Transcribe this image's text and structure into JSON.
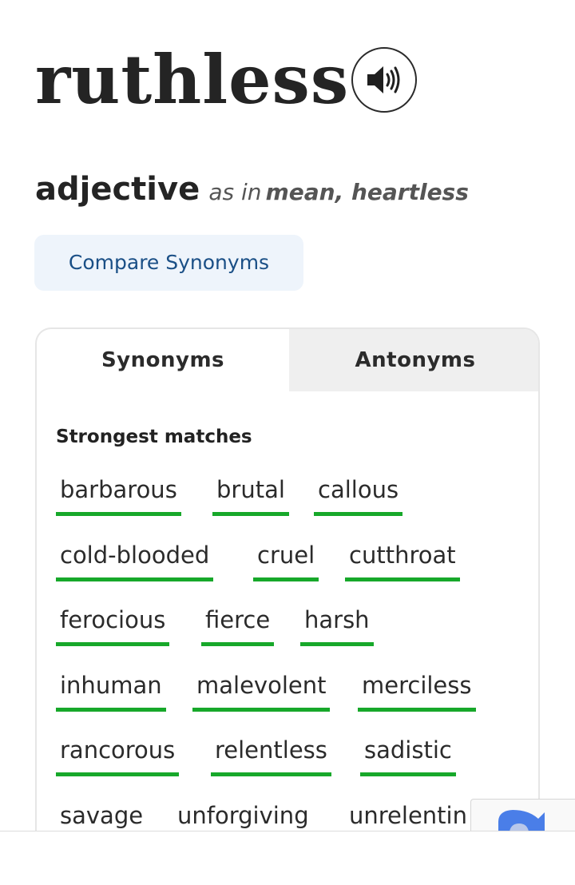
{
  "entry": {
    "word": "ruthless",
    "part_of_speech": "adjective",
    "as_in_prefix": "as in",
    "as_in_words": "mean, heartless"
  },
  "audio": {
    "icon": "speaker-icon"
  },
  "compare_button": {
    "label": "Compare Synonyms"
  },
  "tabs": [
    {
      "label": "Synonyms",
      "active": true
    },
    {
      "label": "Antonyms",
      "active": false
    }
  ],
  "section": {
    "title": "Strongest matches"
  },
  "synonym_rows": [
    [
      {
        "text": "barbarous",
        "strong": true
      },
      {
        "text": "brutal",
        "strong": true
      },
      {
        "text": "callous",
        "strong": true
      }
    ],
    [
      {
        "text": "cold-blooded",
        "strong": true
      },
      {
        "text": "cruel",
        "strong": true
      },
      {
        "text": "cutthroat",
        "strong": true
      }
    ],
    [
      {
        "text": "ferocious",
        "strong": true
      },
      {
        "text": "fierce",
        "strong": true
      },
      {
        "text": "harsh",
        "strong": true
      }
    ],
    [
      {
        "text": "inhuman",
        "strong": true
      },
      {
        "text": "malevolent",
        "strong": true
      },
      {
        "text": "merciless",
        "strong": true
      }
    ],
    [
      {
        "text": "rancorous",
        "strong": true
      },
      {
        "text": "relentless",
        "strong": true
      },
      {
        "text": "sadistic",
        "strong": true
      }
    ],
    [
      {
        "text": "savage",
        "strong": false
      },
      {
        "text": "unforgiving",
        "strong": false
      },
      {
        "text": "unrelentin",
        "strong": false
      }
    ]
  ],
  "colors": {
    "strong_underline": "#17a82a",
    "compare_bg": "#eef4fb",
    "compare_text": "#1a4f86",
    "inactive_tab_bg": "#efefef"
  },
  "recaptcha": {
    "icon": "recaptcha-logo-icon"
  }
}
